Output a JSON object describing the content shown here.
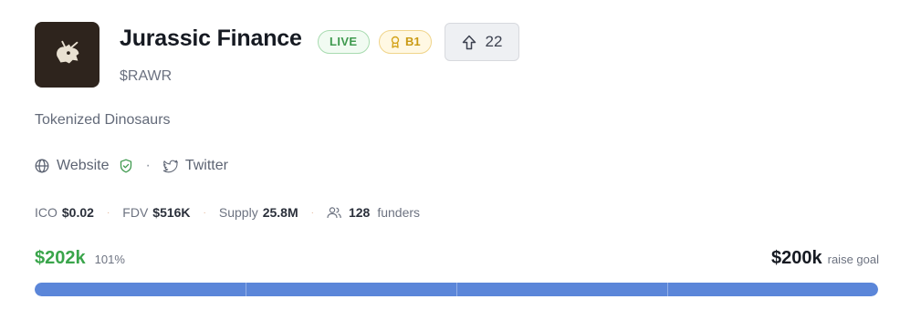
{
  "project": {
    "name": "Jurassic Finance",
    "ticker": "$RAWR",
    "description": "Tokenized Dinosaurs",
    "logo_icon": "triceratops-skull-icon"
  },
  "badges": {
    "status": "LIVE",
    "rank": "B1",
    "rank_icon": "medal-icon"
  },
  "upvote": {
    "count": "22",
    "icon": "arrow-up-icon"
  },
  "links": {
    "website": "Website",
    "website_icon": "globe-icon",
    "verified_icon": "shield-check-icon",
    "separator": "·",
    "twitter": "Twitter",
    "twitter_icon": "twitter-icon"
  },
  "stats": {
    "ico_label": "ICO",
    "ico_value": "$0.02",
    "fdv_label": "FDV",
    "fdv_value": "$516K",
    "supply_label": "Supply",
    "supply_value": "25.8M",
    "funders_count": "128",
    "funders_label": "funders",
    "funders_icon": "users-icon",
    "separator": "·"
  },
  "raise": {
    "raised": "$202k",
    "percent": "101%",
    "goal": "$200k",
    "goal_label": "raise goal",
    "progress": 1.0
  },
  "colors": {
    "live": "#3f9a4f",
    "rank": "#c99a14",
    "raised": "#3aa54b",
    "progress_bar": "#5b86d9"
  }
}
